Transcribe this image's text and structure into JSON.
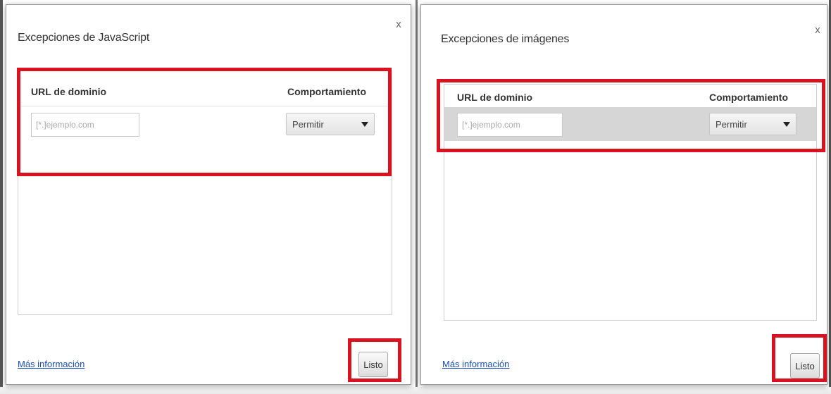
{
  "left_dialog": {
    "title": "Excepciones de JavaScript",
    "close_label": "x",
    "columns": {
      "url": "URL de dominio",
      "behavior": "Comportamiento"
    },
    "url_placeholder": "[*.]ejemplo.com",
    "behavior_value": "Permitir",
    "more_info": "Más información",
    "done_label": "Listo"
  },
  "right_dialog": {
    "title": "Excepciones de imágenes",
    "close_label": "x",
    "columns": {
      "url": "URL de dominio",
      "behavior": "Comportamiento"
    },
    "url_placeholder": "[*.]ejemplo.com",
    "behavior_value": "Permitir",
    "more_info": "Más información",
    "done_label": "Listo"
  },
  "highlight_color": "#d9121f",
  "link_color": "#1a4fb8"
}
